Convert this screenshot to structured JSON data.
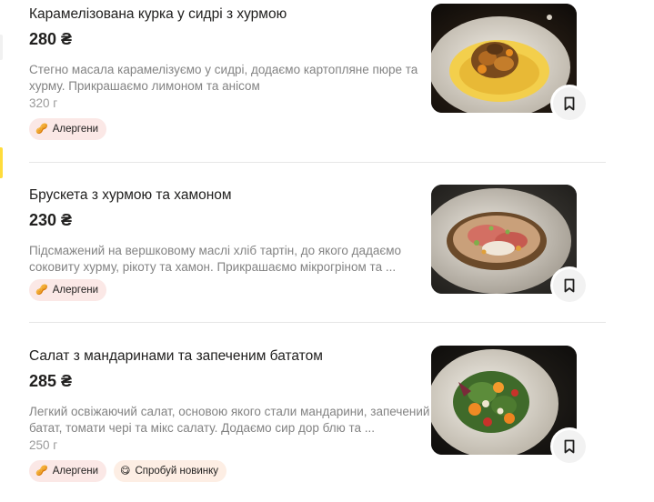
{
  "page": {
    "accent_color": "#ffdc3c",
    "allergen_tag_color": "#fbe8e6",
    "new_tag_color": "#fdeee4"
  },
  "menu": {
    "items": [
      {
        "title": "Карамелізована курка у сидрі з хурмою",
        "price": "280 ₴",
        "description_lines": [
          "Стегно масала карамелізуємо у сидрі, додаємо картопляне пюре та",
          "хурму. Прикрашаємо лимоном та анісом"
        ],
        "weight": "320 г",
        "tags": [
          {
            "label": "Алергени",
            "icon": "allergens-icon",
            "kind": "allergen"
          }
        ],
        "photo": "caramelized-chicken-photo",
        "bookmark_icon": "bookmark-icon"
      },
      {
        "title": "Брускета з хурмою та хамоном",
        "price": "230 ₴",
        "description_lines": [
          "Підсмажений на вершковому маслі хліб тартін, до якого дадаємо",
          "соковиту хурму, рікоту та хамон. Прикрашаємо мікрогріном та ..."
        ],
        "weight": "",
        "tags": [
          {
            "label": "Алергени",
            "icon": "allergens-icon",
            "kind": "allergen"
          }
        ],
        "photo": "bruschetta-photo",
        "bookmark_icon": "bookmark-icon"
      },
      {
        "title": "Салат з мандаринами та запеченим бататом",
        "price": "285 ₴",
        "description_lines": [
          "Легкий освіжаючий салат, основою якого стали мандарини, запечений",
          "батат, томати чері та мікс салату. Додаємо сир дор блю та ..."
        ],
        "weight": "250 г",
        "tags": [
          {
            "label": "Алергени",
            "icon": "allergens-icon",
            "kind": "allergen"
          },
          {
            "label": "Спробуй новинку",
            "icon": "smiley-icon",
            "kind": "new"
          }
        ],
        "photo": "tangerine-salad-photo",
        "bookmark_icon": "bookmark-icon"
      }
    ]
  }
}
